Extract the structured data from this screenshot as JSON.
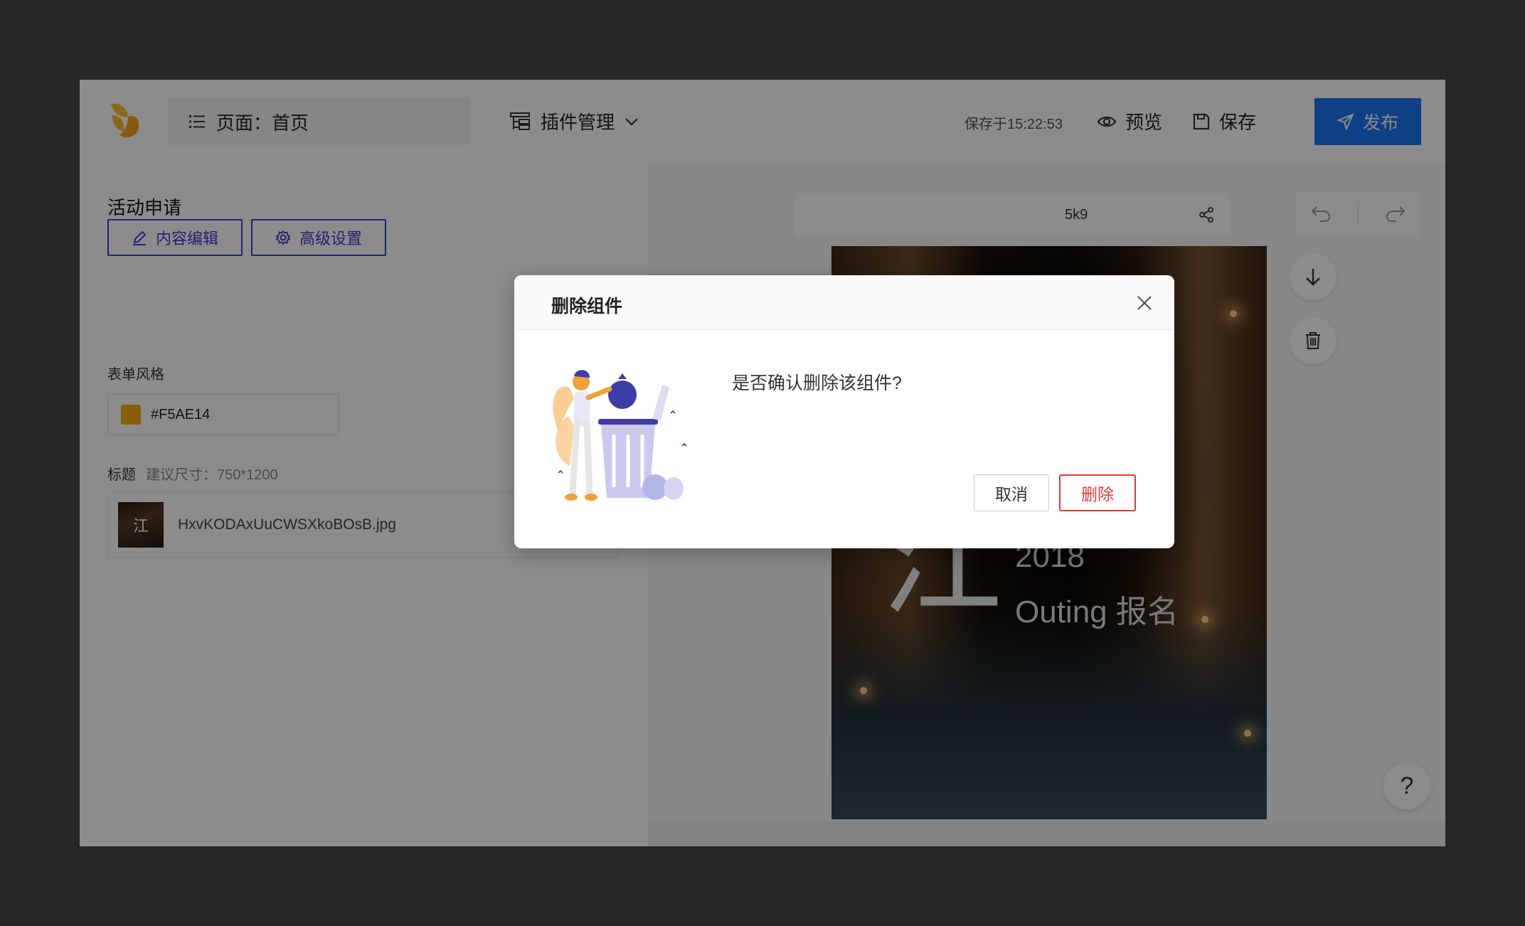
{
  "header": {
    "page_label": "页面：首页",
    "plugin_label": "插件管理",
    "save_time": "保存于15:22:53",
    "preview_label": "预览",
    "save_label": "保存",
    "publish_label": "发布"
  },
  "left_panel": {
    "title": "活动申请",
    "tabs": [
      {
        "label": "内容编辑",
        "icon": "pencil-icon"
      },
      {
        "label": "高级设置",
        "icon": "gear-icon"
      }
    ],
    "form_style_label": "表单风格",
    "form_color": "#F5AE14",
    "title_label": "标题",
    "title_hint": "建议尺寸：750*1200",
    "file_name": "HxvKODAxUuCWSXkoBOsB.jpg",
    "thumb_char": "江"
  },
  "canvas": {
    "url_fragment": "5k9",
    "poster": {
      "char": "江",
      "year": "2018",
      "subtitle": "Outing 报名"
    },
    "help_label": "?"
  },
  "modal": {
    "title": "删除组件",
    "message": "是否确认删除该组件?",
    "cancel_label": "取消",
    "delete_label": "删除"
  },
  "colors": {
    "accent": "#1D73F0",
    "tab_border": "#3B3BD6",
    "danger": "#E53935",
    "form_color": "#F5AE14"
  }
}
